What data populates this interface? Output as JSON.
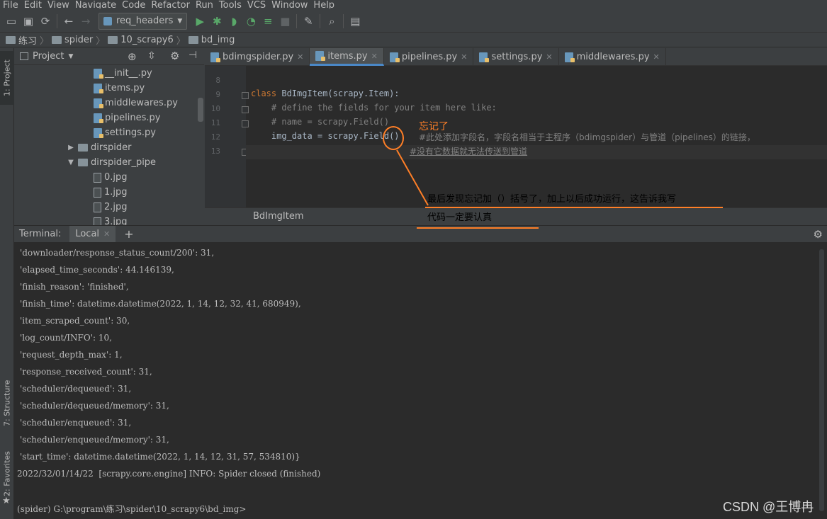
{
  "menu": [
    "File",
    "Edit",
    "View",
    "Navigate",
    "Code",
    "Refactor",
    "Run",
    "Tools",
    "VCS",
    "Window",
    "Help"
  ],
  "toolbar": {
    "run_config": "req_headers"
  },
  "breadcrumbs": [
    "练习",
    "spider",
    "10_scrapy6",
    "bd_img"
  ],
  "sidebar": {
    "left_tabs": [
      "1: Project",
      "7: Structure",
      "2: Favorites"
    ],
    "project_label": "Project"
  },
  "tree": [
    {
      "label": "__init__.py",
      "type": "py"
    },
    {
      "label": "items.py",
      "type": "py"
    },
    {
      "label": "middlewares.py",
      "type": "py"
    },
    {
      "label": "pipelines.py",
      "type": "py"
    },
    {
      "label": "settings.py",
      "type": "py"
    },
    {
      "label": "dirspider",
      "type": "folder-collapsed"
    },
    {
      "label": "dirspider_pipe",
      "type": "folder-expanded"
    },
    {
      "label": "0.jpg",
      "type": "jpg"
    },
    {
      "label": "1.jpg",
      "type": "jpg"
    },
    {
      "label": "2.jpg",
      "type": "jpg"
    },
    {
      "label": "3.jpg",
      "type": "jpg"
    }
  ],
  "editor": {
    "tabs": [
      {
        "label": "bdimgspider.py",
        "active": false
      },
      {
        "label": "items.py",
        "active": true
      },
      {
        "label": "pipelines.py",
        "active": false
      },
      {
        "label": "settings.py",
        "active": false
      },
      {
        "label": "middlewares.py",
        "active": false
      }
    ],
    "line_numbers": [
      "8",
      "9",
      "10",
      "11",
      "12",
      "13"
    ],
    "code": {
      "l9_kw": "class",
      "l9_rest": " BdImgItem(scrapy.Item):",
      "l10": "    # define the fields for your item here like:",
      "l11": "    # name = scrapy.Field()",
      "l12": "    img_data = scrapy.Field()",
      "l12_comment": "#此处添加字段名，字段名相当于主程序（bdimgspider）与管道（pipelines）的链接，",
      "l13_comment": "#没有它数据就无法传送到管道"
    },
    "structure_crumb": "BdImgItem"
  },
  "annotations": {
    "forgot": "忘记了",
    "note_line1": "最后发现忘记加（）括号了，加上以后成功运行，这告诉我写",
    "note_line2": "代码一定要认真"
  },
  "terminal": {
    "title": "Terminal:",
    "tab": "Local",
    "lines": [
      "'downloader/response_status_count/200': 31,",
      "'elapsed_time_seconds': 44.146139,",
      "'finish_reason': 'finished',",
      "'finish_time': datetime.datetime(2022, 1, 14, 12, 32, 41, 680949),",
      "'item_scraped_count': 30,",
      "'log_count/INFO': 10,",
      "'request_depth_max': 1,",
      "'response_received_count': 31,",
      "'scheduler/dequeued': 31,",
      "'scheduler/dequeued/memory': 31,",
      "'scheduler/enqueued': 31,",
      "'scheduler/enqueued/memory': 31,",
      "'start_time': datetime.datetime(2022, 1, 14, 12, 31, 57, 534810)}",
      "2022/32/01/14/22  [scrapy.core.engine] INFO: Spider closed (finished)"
    ],
    "prompt": "(spider) G:\\program\\练习\\spider\\10_scrapy6\\bd_img>"
  },
  "watermark": "CSDN @王博冉"
}
